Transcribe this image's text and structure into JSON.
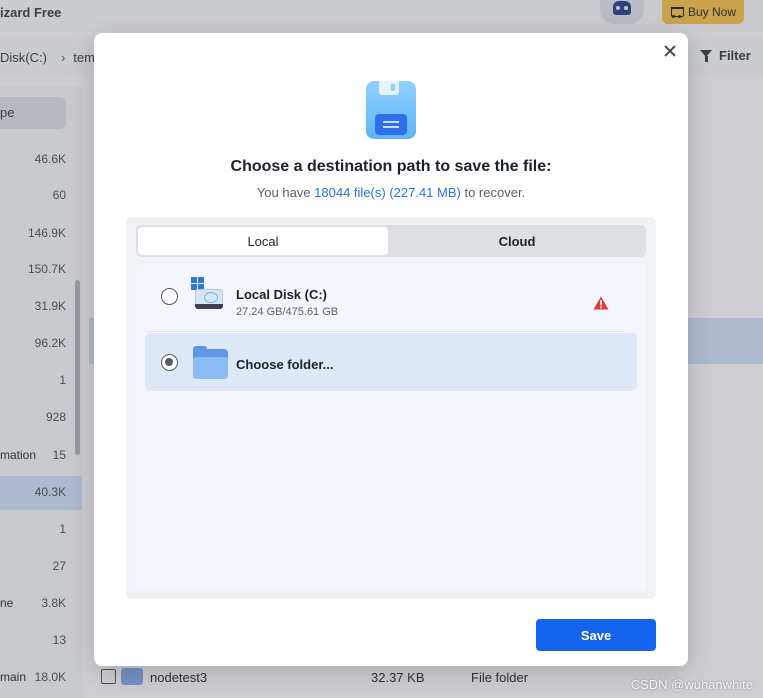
{
  "background": {
    "app_title": "izard Free",
    "buy_now_label": "Buy Now",
    "path": [
      "Disk(C:)",
      "tem"
    ],
    "filter_label": "Filter",
    "type_chip_label": "pe",
    "sidebar_rows": [
      {
        "label": "",
        "count": "46.6K"
      },
      {
        "label": "",
        "count": "60"
      },
      {
        "label": "",
        "count": "146.9K"
      },
      {
        "label": "",
        "count": "150.7K"
      },
      {
        "label": "",
        "count": "31.9K"
      },
      {
        "label": "",
        "count": "96.2K"
      },
      {
        "label": "",
        "count": "1"
      },
      {
        "label": "",
        "count": "928"
      },
      {
        "label": "mation",
        "count": "15"
      },
      {
        "label": "",
        "count": "40.3K"
      },
      {
        "label": "",
        "count": "1"
      },
      {
        "label": "",
        "count": "27"
      },
      {
        "label": "ne",
        "count": "3.8K"
      },
      {
        "label": "",
        "count": "13"
      },
      {
        "label": "main",
        "count": "18.0K"
      }
    ],
    "file_row": {
      "name": "nodetest3",
      "size": "32.37 KB",
      "type": "File folder"
    },
    "watermark": "CSDN @wuhanwhite"
  },
  "dialog": {
    "title": "Choose a destination path to save the file:",
    "subtitle_prefix": "You have ",
    "subtitle_highlight": "18044 file(s) (227.41 MB)",
    "subtitle_suffix": " to recover.",
    "tabs": [
      {
        "label": "Local",
        "active": true
      },
      {
        "label": "Cloud",
        "active": false
      }
    ],
    "destinations": [
      {
        "name": "Local Disk (C:)",
        "detail": "27.24 GB/475.61 GB",
        "selected": false,
        "warning": true
      },
      {
        "name": "Choose folder...",
        "selected": true
      }
    ],
    "save_label": "Save"
  },
  "colors": {
    "accent": "#1464f0",
    "highlight_text": "#2b6ee6",
    "warning": "#e53935",
    "selected_row": "#dde8f8"
  }
}
